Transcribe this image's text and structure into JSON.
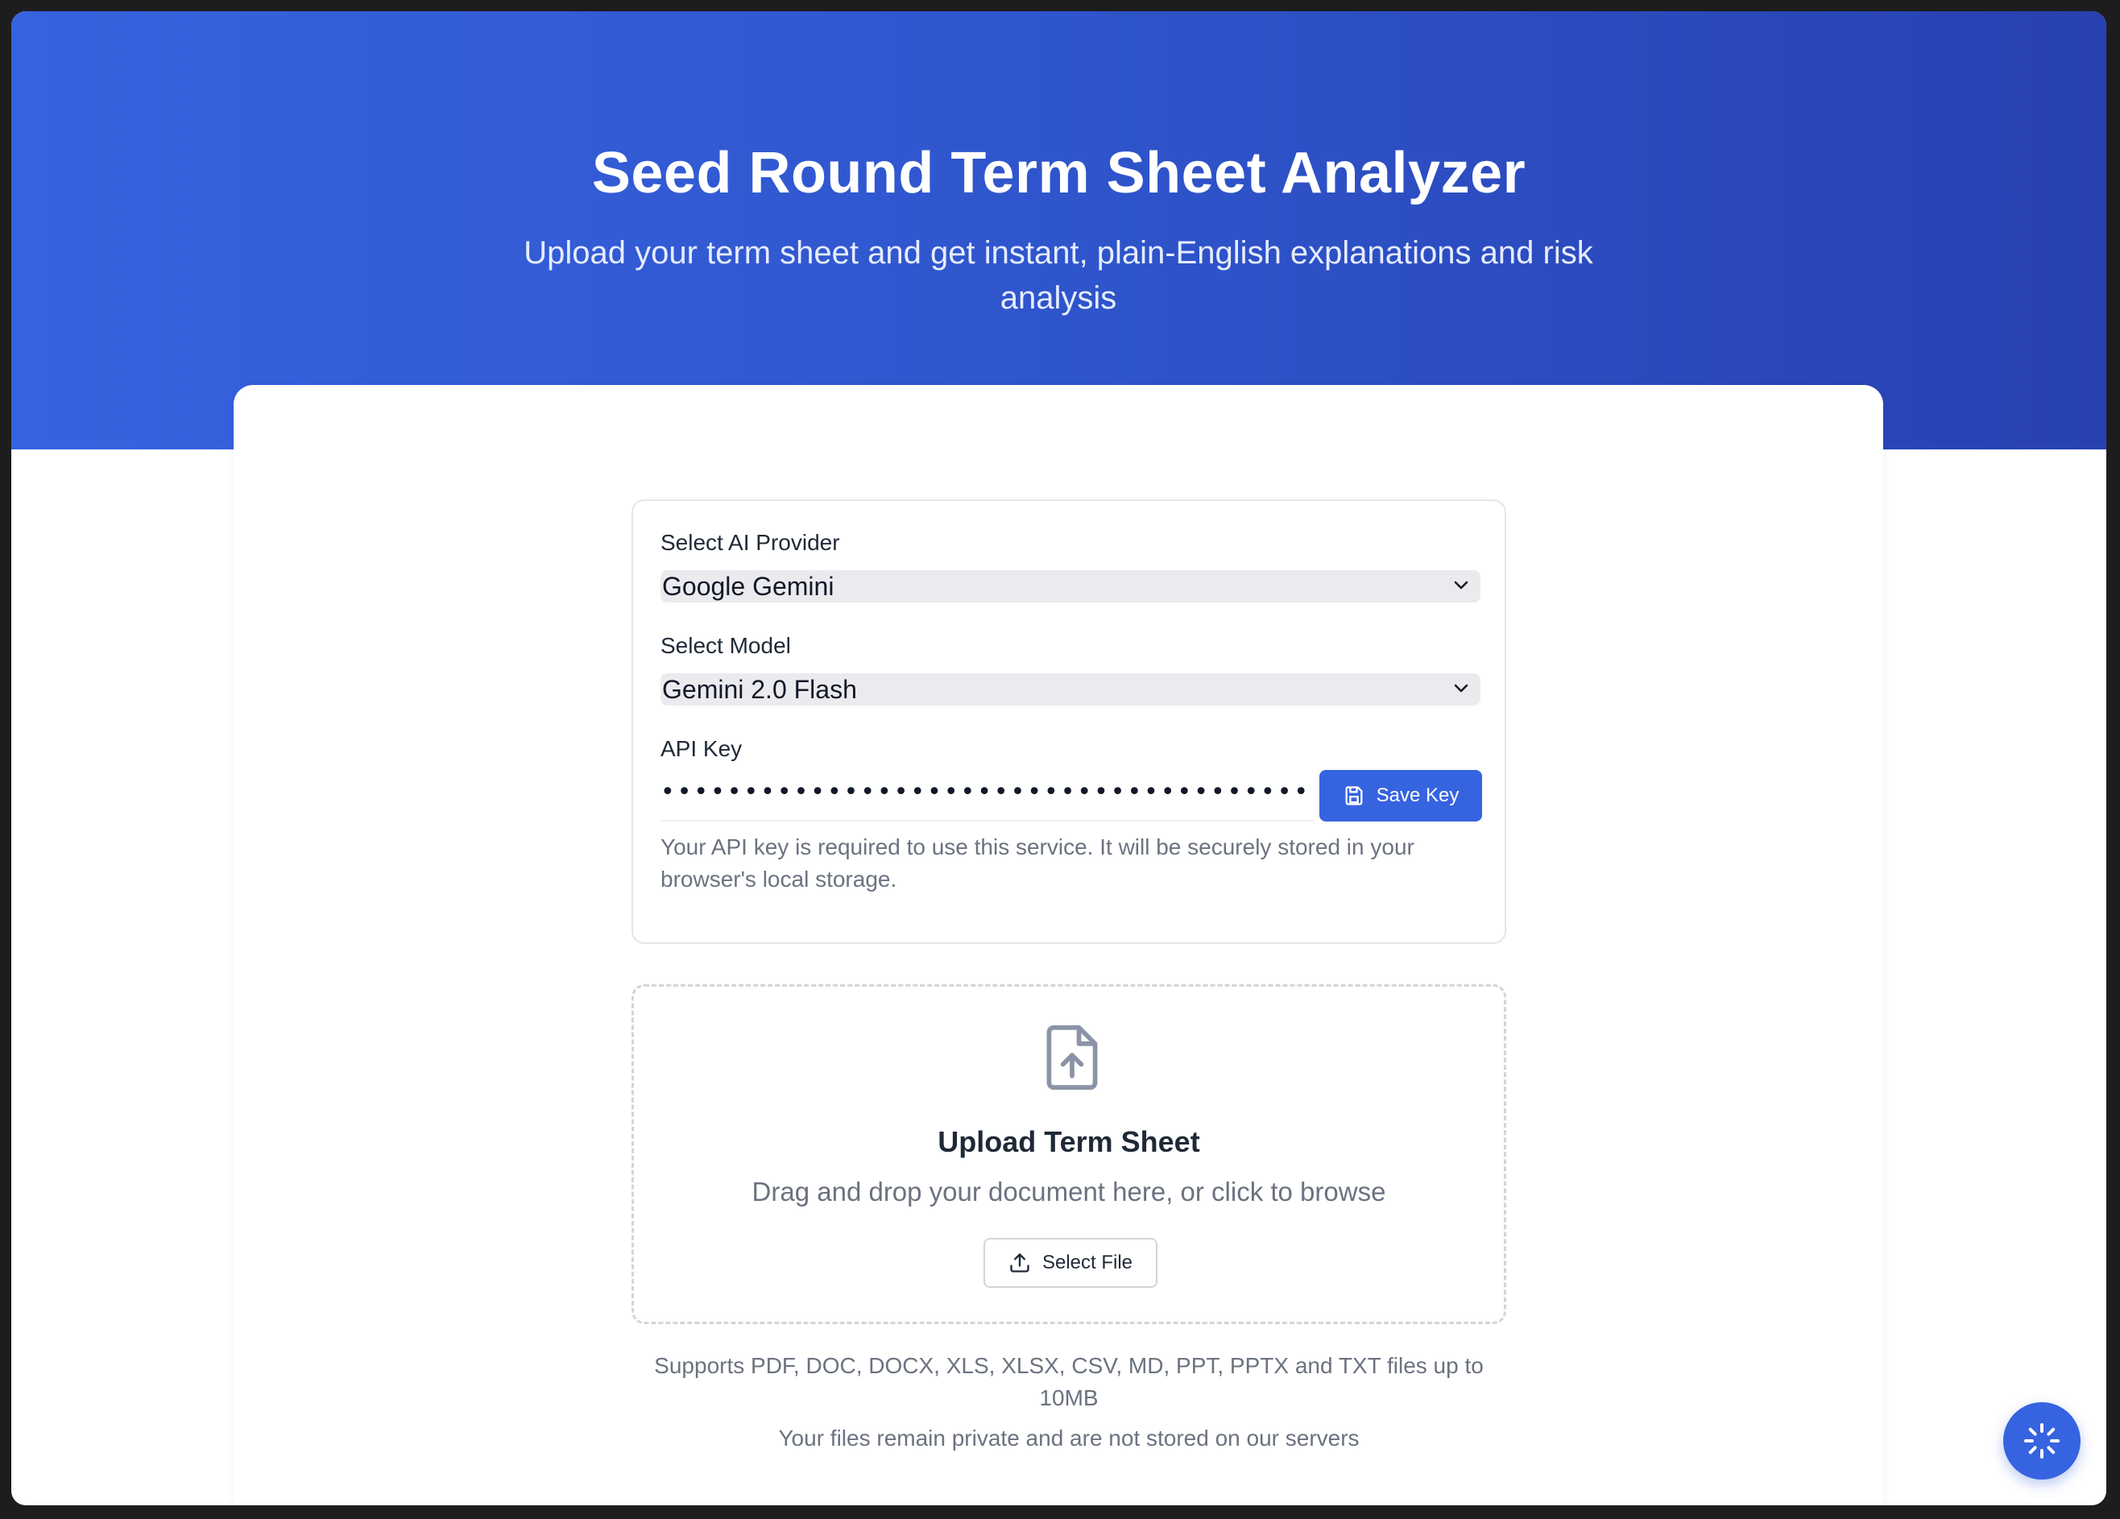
{
  "header": {
    "title": "Seed Round Term Sheet Analyzer",
    "subtitle": "Upload your term sheet and get instant, plain-English explanations and risk analysis"
  },
  "settings": {
    "provider_label": "Select AI Provider",
    "provider_value": "Google Gemini",
    "model_label": "Select Model",
    "model_value": "Gemini 2.0 Flash",
    "api_key_label": "API Key",
    "api_key_value": "•••••••••••••••••••••••••••••••••••••••",
    "save_key_label": "Save Key",
    "helper_text": "Your API key is required to use this service. It will be securely stored in your browser's local storage."
  },
  "upload": {
    "title": "Upload Term Sheet",
    "subtitle": "Drag and drop your document here, or click to browse",
    "button_label": "Select File",
    "supported_text": "Supports PDF, DOC, DOCX, XLS, XLSX, CSV, MD, PPT, PPTX and TXT files up to 10MB",
    "privacy_text": "Your files remain private and are not stored on our servers"
  },
  "colors": {
    "accent": "#3663e0",
    "hero_start": "#3763e0",
    "hero_end": "#2741b0"
  },
  "icons": {
    "save": "save-icon",
    "file_upload": "file-upload-icon",
    "upload": "upload-icon",
    "loader": "loader-icon",
    "chevron": "chevron-down-icon"
  }
}
